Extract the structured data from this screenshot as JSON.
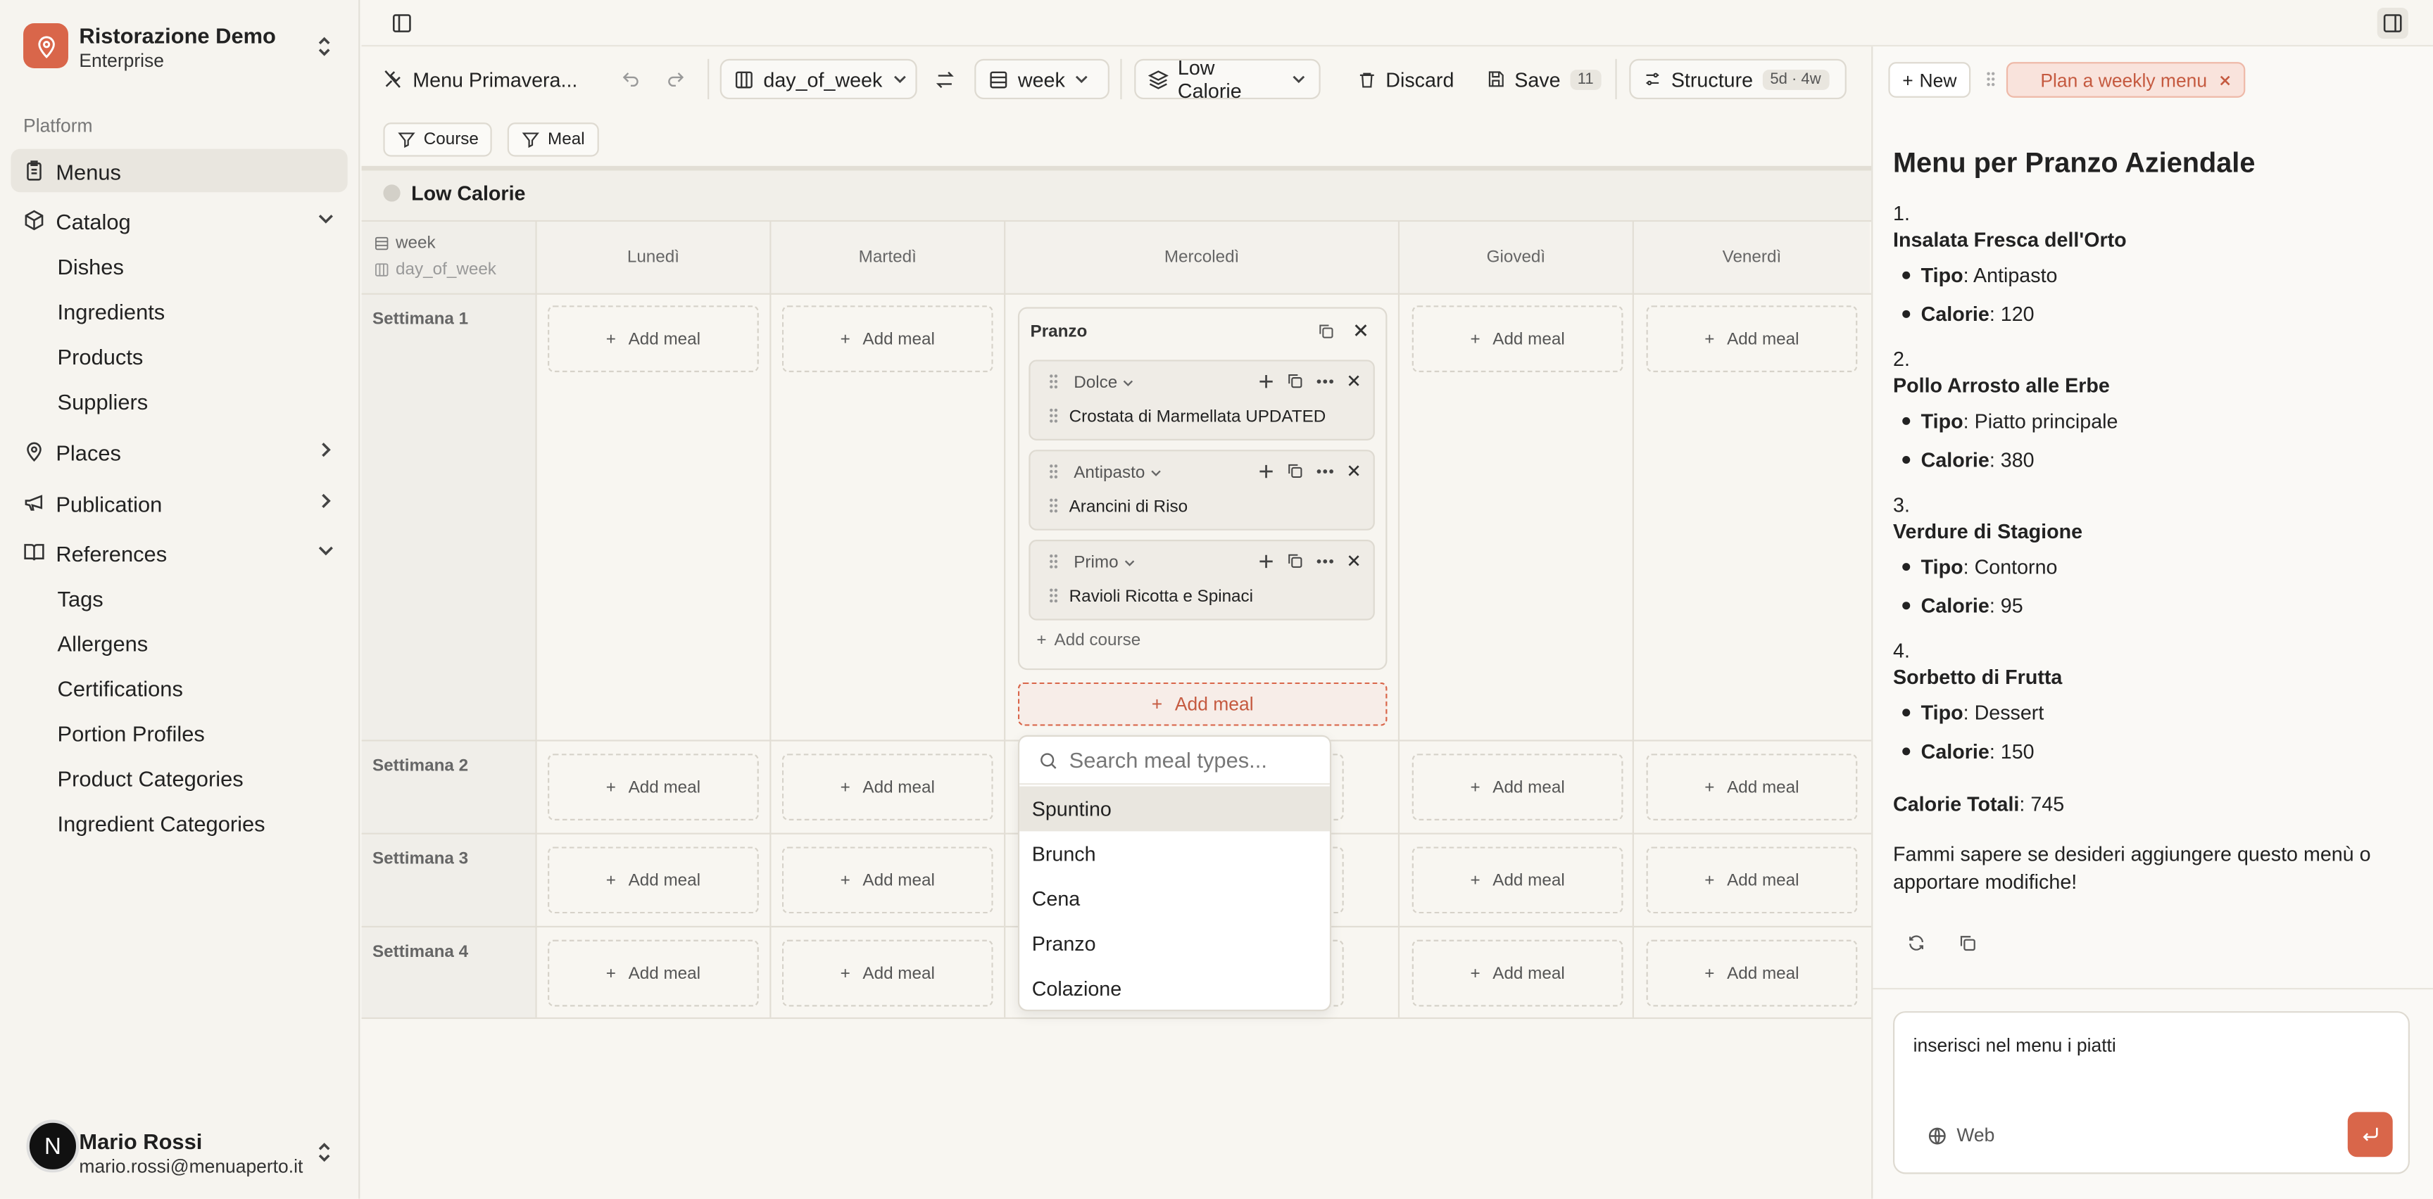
{
  "org": {
    "name": "Ristorazione Demo",
    "plan": "Enterprise"
  },
  "sidebar": {
    "section_label": "Platform",
    "items": [
      {
        "label": "Menus"
      },
      {
        "label": "Catalog",
        "children": [
          "Dishes",
          "Ingredients",
          "Products",
          "Suppliers"
        ]
      },
      {
        "label": "Places"
      },
      {
        "label": "Publication"
      },
      {
        "label": "References",
        "children": [
          "Tags",
          "Allergens",
          "Certifications",
          "Portion Profiles",
          "Product Categories",
          "Ingredient Categories"
        ]
      }
    ]
  },
  "user": {
    "initial": "N",
    "name": "Mario Rossi",
    "email": "mario.rossi@menuaperto.it"
  },
  "toolbar": {
    "menu_name": "Menu Primavera...",
    "columns_select": "day_of_week",
    "rows_select": "week",
    "variant_select": "Low Calorie",
    "discard_label": "Discard",
    "save_label": "Save",
    "save_count": "11",
    "structure_label": "Structure",
    "structure_badge": "5d · 4w"
  },
  "filters": [
    "Course",
    "Meal"
  ],
  "board": {
    "group_title": "Low Calorie",
    "corner_row": "week",
    "corner_col": "day_of_week",
    "days": [
      "Lunedì",
      "Martedì",
      "Mercoledì",
      "Giovedì",
      "Venerdì"
    ],
    "weeks": [
      "Settimana 1",
      "Settimana 2",
      "Settimana 3",
      "Settimana 4"
    ],
    "add_meal_label": "Add meal",
    "meal": {
      "title": "Pranzo",
      "courses": [
        {
          "type": "Dolce",
          "dish": "Crostata di Marmellata UPDATED"
        },
        {
          "type": "Antipasto",
          "dish": "Arancini di Riso"
        },
        {
          "type": "Primo",
          "dish": "Ravioli Ricotta e Spinaci"
        }
      ],
      "add_course_label": "Add course"
    },
    "dropdown": {
      "placeholder": "Search meal types...",
      "options": [
        "Spuntino",
        "Brunch",
        "Cena",
        "Pranzo",
        "Colazione"
      ]
    }
  },
  "chat": {
    "new_label": "New",
    "tab_label": "Plan a weekly menu",
    "heading": "Menu per Pranzo Aziendale",
    "dishes": [
      {
        "num": "1.",
        "name": "Insalata Fresca dell'Orto",
        "tipo": "Antipasto",
        "calorie": "120"
      },
      {
        "num": "2.",
        "name": "Pollo Arrosto alle Erbe",
        "tipo": "Piatto principale",
        "calorie": "380"
      },
      {
        "num": "3.",
        "name": "Verdure di Stagione",
        "tipo": "Contorno",
        "calorie": "95"
      },
      {
        "num": "4.",
        "name": "Sorbetto di Frutta",
        "tipo": "Dessert",
        "calorie": "150"
      }
    ],
    "tipo_label": "Tipo",
    "calorie_label": "Calorie",
    "total_label": "Calorie Totali",
    "total_value": "745",
    "closing": "Fammi sapere se desideri aggiungere questo menù o apportare modifiche!",
    "input_text": "inserisci nel menu i piatti",
    "web_label": "Web"
  },
  "colors": {
    "accent": "#d9664a",
    "accent_soft": "#f9e3dc"
  }
}
